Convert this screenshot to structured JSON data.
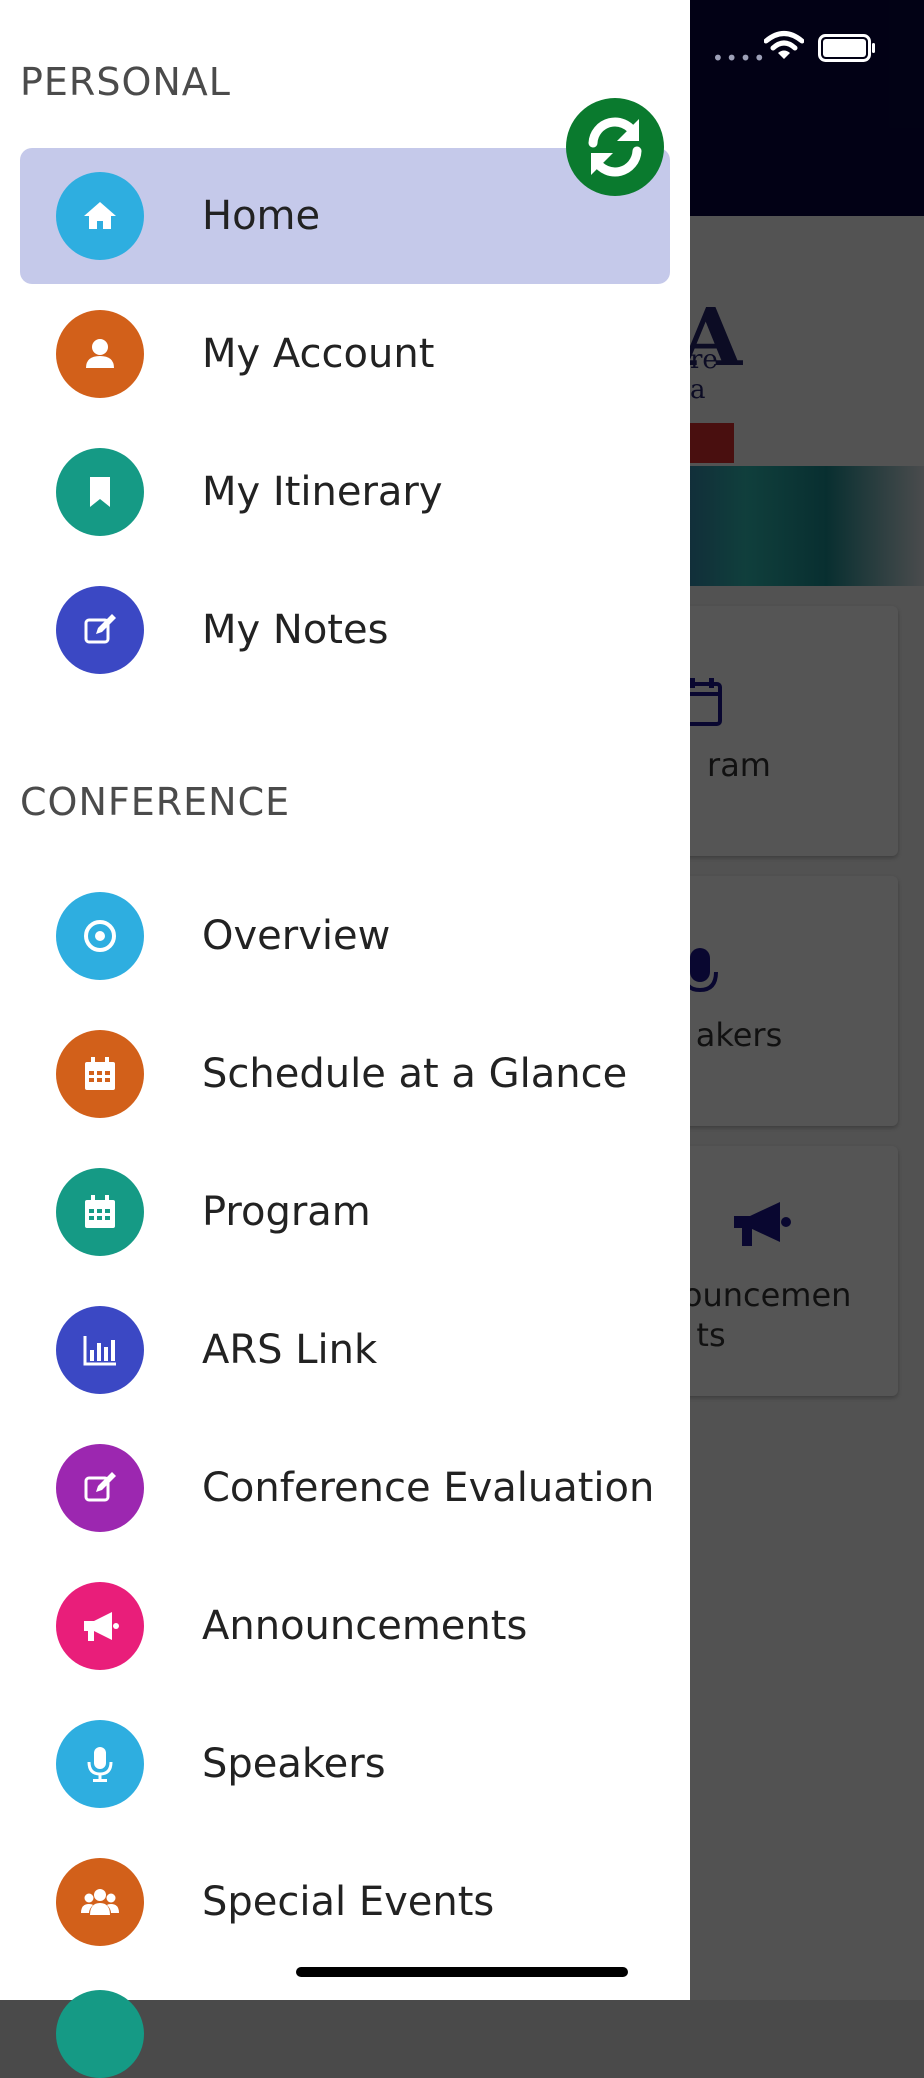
{
  "status_bar": {
    "signal_dots": "••••"
  },
  "background_app": {
    "logo_letter": "A",
    "logo_line1": "re",
    "logo_line2": "a",
    "tiles": [
      {
        "label_line1": "ram",
        "label_line2": "",
        "icon": "calendar-icon"
      },
      {
        "label_line1": "akers",
        "label_line2": "",
        "icon": "microphone-icon"
      },
      {
        "label_line1": "nouncemen",
        "label_line2": "ts",
        "icon": "megaphone-icon"
      }
    ]
  },
  "drawer": {
    "personal_title": "PERSONAL",
    "conference_title": "CONFERENCE",
    "personal_items": [
      {
        "label": "Home",
        "icon": "home-icon",
        "color": "#2eaee0",
        "active": true
      },
      {
        "label": "My Account",
        "icon": "user-icon",
        "color": "#d2601a"
      },
      {
        "label": "My Itinerary",
        "icon": "bookmark-icon",
        "color": "#159a85"
      },
      {
        "label": "My Notes",
        "icon": "edit-icon",
        "color": "#3b48c4"
      }
    ],
    "conference_items": [
      {
        "label": "Overview",
        "icon": "target-icon",
        "color": "#2eaee0"
      },
      {
        "label": "Schedule at a Glance",
        "icon": "calendar-icon",
        "color": "#d2601a"
      },
      {
        "label": "Program",
        "icon": "calendar-icon",
        "color": "#159a85"
      },
      {
        "label": "ARS Link",
        "icon": "bar-chart-icon",
        "color": "#3b48c4"
      },
      {
        "label": "Conference Evaluation",
        "icon": "edit-icon",
        "color": "#9c27b0"
      },
      {
        "label": "Announcements",
        "icon": "megaphone-icon",
        "color": "#e91e7a"
      },
      {
        "label": "Speakers",
        "icon": "microphone-icon",
        "color": "#2eaee0"
      },
      {
        "label": "Special Events",
        "icon": "users-icon",
        "color": "#d2601a"
      }
    ],
    "refresh_color": "#0a7a2e"
  }
}
